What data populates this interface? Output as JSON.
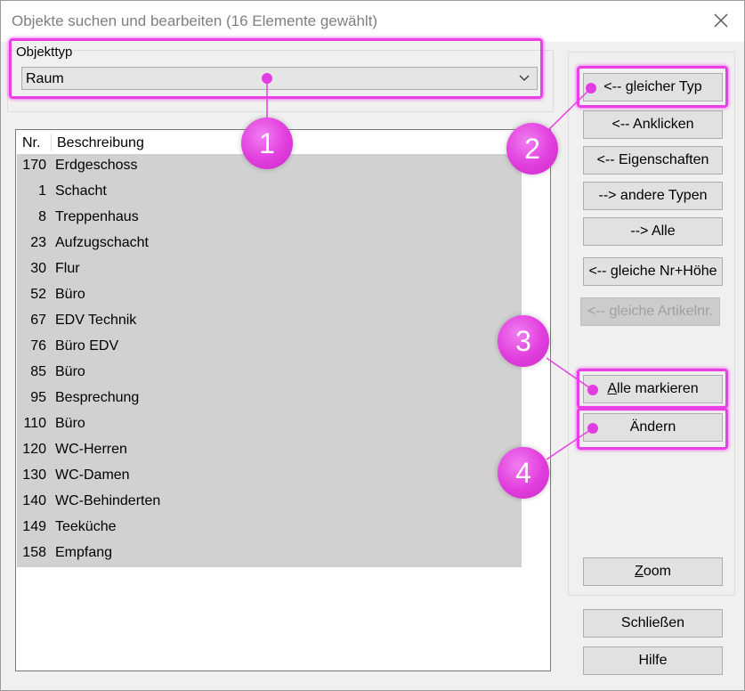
{
  "window": {
    "title": "Objekte suchen und bearbeiten (16 Elemente gewählt)",
    "close_icon": "close-icon"
  },
  "objekttyp": {
    "label": "Objekttyp",
    "selected": "Raum"
  },
  "list": {
    "columns": [
      "Nr.",
      "Beschreibung"
    ],
    "rows": [
      {
        "nr": "170",
        "desc": "Erdgeschoss"
      },
      {
        "nr": "1",
        "desc": "Schacht"
      },
      {
        "nr": "8",
        "desc": "Treppenhaus"
      },
      {
        "nr": "23",
        "desc": "Aufzugschacht"
      },
      {
        "nr": "30",
        "desc": "Flur"
      },
      {
        "nr": "52",
        "desc": "Büro"
      },
      {
        "nr": "67",
        "desc": "EDV Technik"
      },
      {
        "nr": "76",
        "desc": "Büro EDV"
      },
      {
        "nr": "85",
        "desc": "Büro"
      },
      {
        "nr": "95",
        "desc": "Besprechung"
      },
      {
        "nr": "110",
        "desc": "Büro"
      },
      {
        "nr": "120",
        "desc": "WC-Herren"
      },
      {
        "nr": "130",
        "desc": "WC-Damen"
      },
      {
        "nr": "140",
        "desc": "WC-Behinderten"
      },
      {
        "nr": "149",
        "desc": "Teeküche"
      },
      {
        "nr": "158",
        "desc": "Empfang"
      }
    ]
  },
  "buttons": {
    "gleicher_typ": "<-- gleicher Typ",
    "anklicken": "<-- Anklicken",
    "eigenschaften": "<-- Eigenschaften",
    "andere_typen": "--> andere Typen",
    "alle": "--> Alle",
    "gleiche_nr_hoehe": "<-- gleiche Nr+Höhe",
    "gleiche_artikelnr": "<-- gleiche Artikelnr.",
    "alle_markieren_first": "A",
    "alle_markieren_rest": "lle markieren",
    "aendern": "Ändern",
    "zoom_first": "Z",
    "zoom_rest": "oom",
    "schliessen": "Schließen",
    "hilfe": "Hilfe"
  },
  "markers": [
    "1",
    "2",
    "3",
    "4"
  ],
  "colors": {
    "annotation": "#ea3ee6",
    "selection": "#d1d1d1"
  }
}
